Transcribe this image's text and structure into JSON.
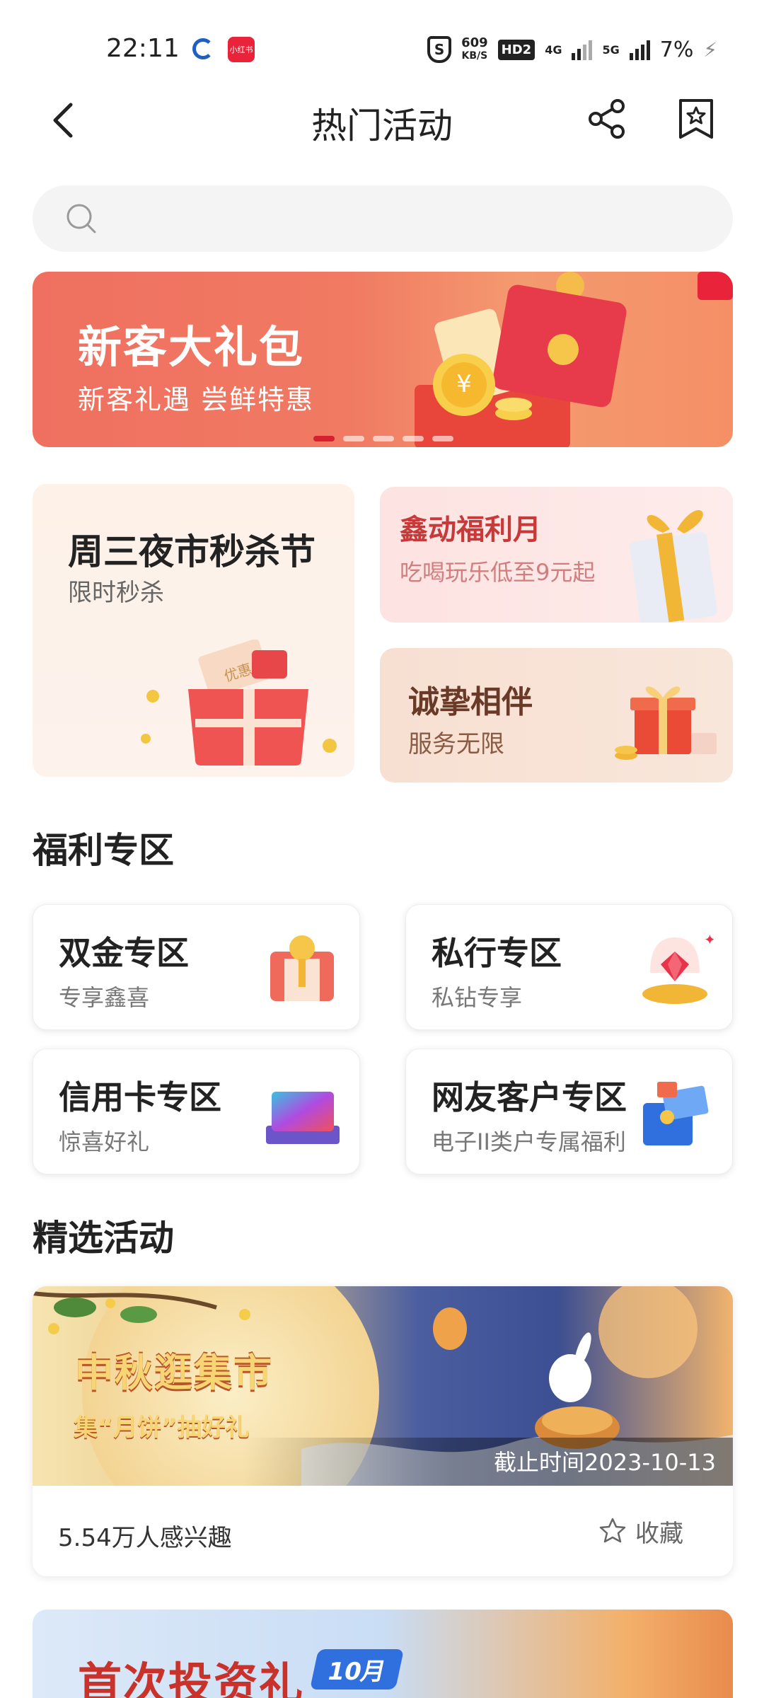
{
  "status_bar": {
    "time": "22:11",
    "app_badge": "小红书",
    "shield": "S",
    "speed_value": "609",
    "speed_unit": "KB/S",
    "hd": "HD2",
    "net1": "4G",
    "net2": "5G",
    "battery": "7%"
  },
  "nav": {
    "title": "热门活动"
  },
  "search": {
    "placeholder": ""
  },
  "banner": {
    "title": "新客大礼包",
    "subtitle": "新客礼遇 尝鲜特惠",
    "page_count": 5,
    "active_index": 0
  },
  "promos": {
    "big": {
      "title": "周三夜市秒杀节",
      "subtitle": "限时秒杀",
      "coupon_text": "优惠券"
    },
    "small1": {
      "title": "鑫动福利月",
      "subtitle": "吃喝玩乐低至9元起"
    },
    "small2": {
      "title": "诚挚相伴",
      "subtitle": "服务无限"
    }
  },
  "welfare": {
    "heading": "福利专区",
    "items": [
      {
        "title": "双金专区",
        "subtitle": "专享鑫喜",
        "icon": "gold-gift-icon"
      },
      {
        "title": "私行专区",
        "subtitle": "私钻专享",
        "icon": "diamond-icon"
      },
      {
        "title": "信用卡专区",
        "subtitle": "惊喜好礼",
        "icon": "credit-card-icon"
      },
      {
        "title": "网友客户专区",
        "subtitle": "电子II类户专属福利",
        "icon": "gift-box-icon"
      }
    ]
  },
  "featured": {
    "heading": "精选活动",
    "card1": {
      "title": "中秋逛集市",
      "subtitle": "集“月饼”抽好礼",
      "deadline": "截止时间2023-10-13",
      "interest": "5.54万人感兴趣",
      "fav_label": "收藏"
    },
    "card2": {
      "title": "首次投资礼",
      "badge": "10月"
    }
  },
  "colors": {
    "brand_red": "#d6202f",
    "banner_bg": "#ef7060",
    "text_primary": "#222222",
    "text_secondary": "#777777"
  }
}
